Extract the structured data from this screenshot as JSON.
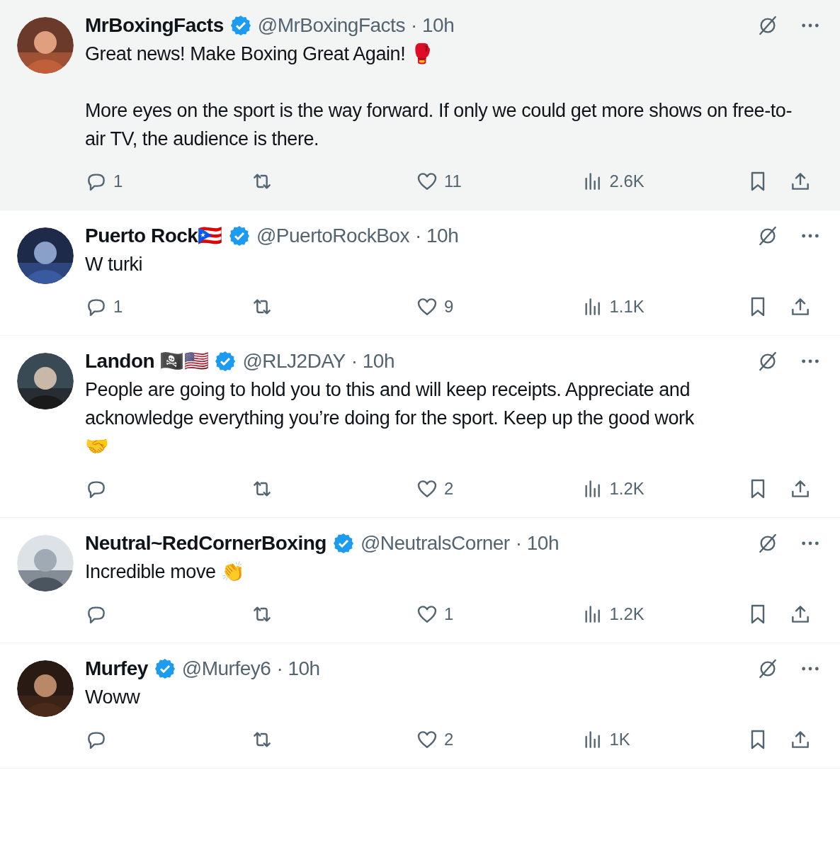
{
  "tweets": [
    {
      "name": "MrBoxingFacts",
      "verified": true,
      "handle": "@MrBoxingFacts",
      "time": "· 10h",
      "text": "Great news!  Make Boxing Great Again! 🥊\n\nMore eyes on the sport is the way forward.   If only we could get more shows on free-to-air TV, the audience is there.",
      "highlighted": true,
      "replies": "1",
      "likes": "11",
      "views": "2.6K"
    },
    {
      "name": "Puerto Rock🇵🇷",
      "verified": true,
      "handle": "@PuertoRockBox",
      "time": "· 10h",
      "text": "W turki",
      "highlighted": false,
      "replies": "1",
      "likes": "9",
      "views": "1.1K"
    },
    {
      "name": "Landon 🏴‍☠️🇺🇸",
      "verified": true,
      "handle": "@RLJ2DAY",
      "time": "· 10h",
      "text": "People are going to hold you to this and will keep receipts. Appreciate and acknowledge everything you’re doing for the sport. Keep up the good work\n🤝",
      "highlighted": false,
      "likes": "2",
      "views": "1.2K"
    },
    {
      "name": "Neutral~RedCornerBoxing",
      "verified": true,
      "handle": "@NeutralsCorner",
      "time": "· 10h",
      "text": "Incredible move 👏",
      "highlighted": false,
      "likes": "1",
      "views": "1.2K"
    },
    {
      "name": "Murfey",
      "verified": true,
      "handle": "@Murfey6",
      "time": "· 10h",
      "text": "Woww",
      "highlighted": false,
      "likes": "2",
      "views": "1K"
    }
  ]
}
